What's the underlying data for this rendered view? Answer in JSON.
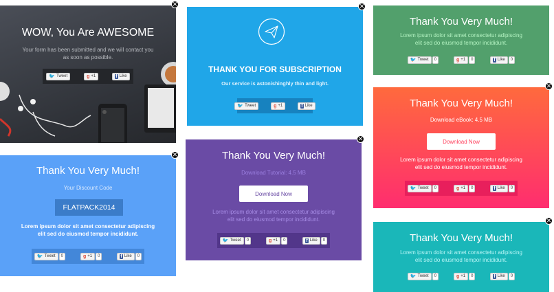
{
  "card1": {
    "title": "WOW, You Are AWESOME",
    "message": "Your form has been submitted and we will contact you as soon as possible.",
    "tweet": "Tweet",
    "gplus": "+1",
    "like": "Like"
  },
  "card2": {
    "title": "THANK YOU FOR SUBSCRIPTION",
    "message": "Our service is astonishinghly thin and light.",
    "tweet": "Tweet",
    "gplus": "+1",
    "like": "Like"
  },
  "card3": {
    "title": "Thank You Very Much!",
    "discount_label": "Your Discount Code",
    "code": "FLATPACK2014",
    "lorem_1": "Lorem ipsum dolor sit amet consectetur adipiscing",
    "lorem_2": "elit sed do eiusmod tempor incididunt.",
    "tweet": "Tweet",
    "tweet_count": "0",
    "gplus": "+1",
    "gplus_count": "0",
    "like": "Like",
    "like_count": "0"
  },
  "card4": {
    "title": "Thank You Very Much!",
    "download_label": "Download Tutorial: 4.5 MB",
    "button": "Download Now",
    "lorem_1": "Lorem ipsum dolor sit amet consectetur adipiscing",
    "lorem_2": "elit sed do eiusmod tempor incididunt.",
    "tweet": "Tweet",
    "tweet_count": "0",
    "gplus": "+1",
    "gplus_count": "0",
    "like": "Like",
    "like_count": "0"
  },
  "card5": {
    "title": "Thank You Very Much!",
    "lorem_1": "Lorem ipsum dolor sit amet consectetur adipiscing",
    "lorem_2": "elit sed do eiusmod tempor incididunt.",
    "tweet": "Tweet",
    "tweet_count": "0",
    "gplus": "+1",
    "gplus_count": "0",
    "like": "Like",
    "like_count": "0"
  },
  "card6": {
    "title": "Thank You Very Much!",
    "download_label": "Download eBook: 4.5 MB",
    "button": "Download Now",
    "lorem_1": "Lorem ipsum dolor sit amet consectetur adipiscing",
    "lorem_2": "elit sed do eiusmod tempor incididunt.",
    "tweet": "Tweet",
    "tweet_count": "0",
    "gplus": "+1",
    "gplus_count": "0",
    "like": "Like",
    "like_count": "0"
  },
  "card7": {
    "title": "Thank You Very Much!",
    "lorem_1": "Lorem ipsum dolor sit amet consectetur adipiscing",
    "lorem_2": "elit sed do eiusmod tempor incididunt.",
    "tweet": "Tweet",
    "tweet_count": "0",
    "gplus": "+1",
    "gplus_count": "0",
    "like": "Like",
    "like_count": "0"
  },
  "close_glyph": "✕",
  "colors": {
    "dark": "#3a3d44",
    "sky": "#20a6e8",
    "blue": "#5aa1f8",
    "purple": "#6a4ba5",
    "green": "#52a06c",
    "red_gradient_top": "#ff6a3d",
    "red_gradient_bottom": "#ff2d6f",
    "teal": "#1ab7b9"
  },
  "icons": [
    "close-icon",
    "paper-plane-icon",
    "twitter-icon",
    "google-plus-icon",
    "facebook-icon"
  ]
}
